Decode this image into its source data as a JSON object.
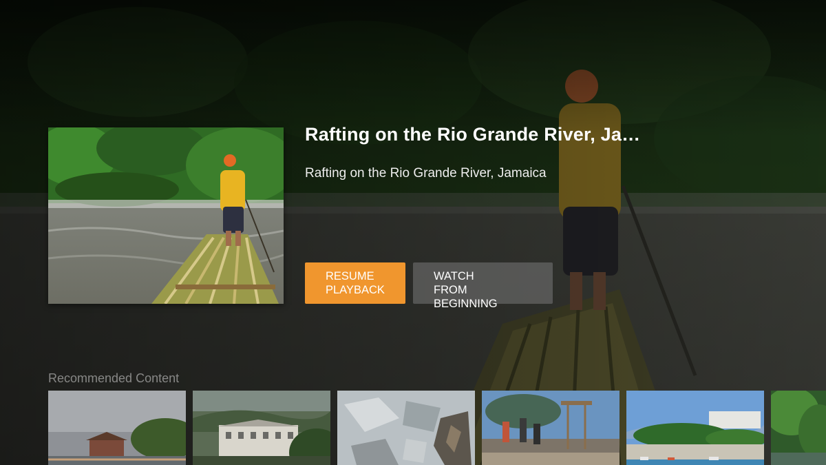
{
  "video": {
    "title": "Rafting on the Rio Grande River, Ja…",
    "description": "Rafting on the Rio Grande River, Jamaica"
  },
  "actions": {
    "resume_line1": "Resume",
    "resume_line2": "Playback",
    "watch_line1": "Watch",
    "watch_line2": "From Beginning"
  },
  "recommended": {
    "heading": "Recommended Content",
    "items": [
      {
        "thumb": "tropical-beach-pier"
      },
      {
        "thumb": "colonial-mansion-hills"
      },
      {
        "thumb": "rock-texture"
      },
      {
        "thumb": "lifeguard-tower-people"
      },
      {
        "thumb": "beach-resort-boats"
      },
      {
        "thumb": "jungle-river"
      }
    ]
  },
  "colors": {
    "accent": "#f0962e",
    "secondary_button": "#787878"
  }
}
